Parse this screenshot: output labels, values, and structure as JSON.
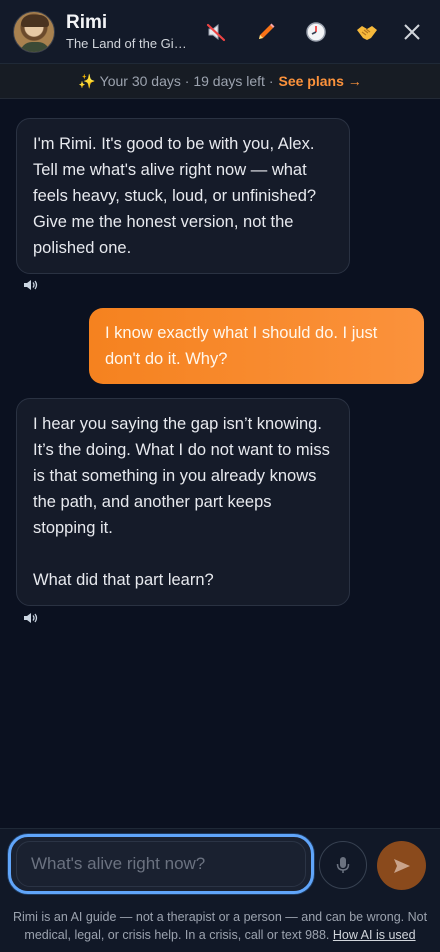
{
  "header": {
    "name": "Rimi",
    "subtitle": "The Land of the Giants",
    "icons": [
      "mute-icon",
      "pencil-icon",
      "clock-icon",
      "handshake-icon",
      "close-icon"
    ]
  },
  "trial": {
    "sparkle": "✨",
    "text": "Your 30 days · 19 days left ·",
    "link": "See plans →"
  },
  "messages": [
    {
      "role": "assistant",
      "text": "I'm Rimi. It's good to be with you, Alex. Tell me what's alive right now — what feels heavy, stuck, loud, or unfinished? Give me the honest version, not the polished one."
    },
    {
      "role": "user",
      "text": "I know exactly what I should do. I just don't do it. Why?"
    },
    {
      "role": "assistant",
      "text": "I hear you saying the gap isn’t knowing. It’s the doing. What I do not want to miss is that something in you already knows the path, and another part keeps stopping it.",
      "text2": "What did that part learn?"
    }
  ],
  "composer": {
    "placeholder": "What's alive right now?"
  },
  "disclaimer": {
    "text": "Rimi is an AI guide — not a therapist or a person — and can be wrong. Not medical, legal, or crisis help. In a crisis, call or text 988.",
    "link": "How AI is used"
  },
  "colors": {
    "accent": "#fb923c",
    "focus_ring": "#60a5fa",
    "background": "#0b1120"
  }
}
